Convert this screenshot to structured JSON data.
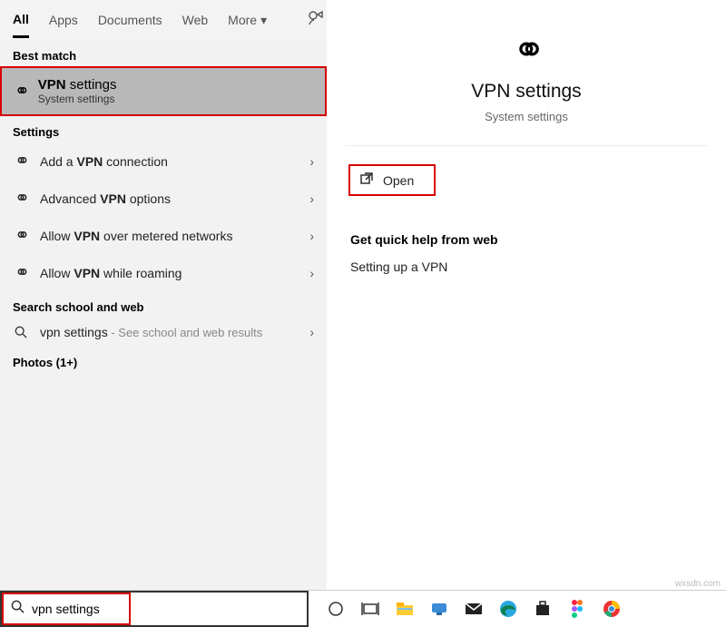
{
  "tabs": {
    "all": "All",
    "apps": "Apps",
    "documents": "Documents",
    "web": "Web",
    "more": "More"
  },
  "left": {
    "best_match_label": "Best match",
    "best_match": {
      "title_pre": "VPN",
      "title_post": " settings",
      "subtitle": "System settings"
    },
    "settings_label": "Settings",
    "items": [
      {
        "pre": "Add a ",
        "bold": "VPN",
        "post": " connection"
      },
      {
        "pre": "Advanced ",
        "bold": "VPN",
        "post": " options"
      },
      {
        "pre": "Allow ",
        "bold": "VPN",
        "post": " over metered networks"
      },
      {
        "pre": "Allow ",
        "bold": "VPN",
        "post": " while roaming"
      }
    ],
    "search_school_label": "Search school and web",
    "web_result": {
      "term": "vpn settings",
      "hint": " - See school and web results"
    },
    "photos_label": "Photos (1+)"
  },
  "right": {
    "title": "VPN settings",
    "subtitle": "System settings",
    "open": "Open",
    "help_heading": "Get quick help from web",
    "help_link": "Setting up a VPN"
  },
  "taskbar": {
    "search_value": "vpn settings"
  },
  "watermark": "wxsdn.com"
}
